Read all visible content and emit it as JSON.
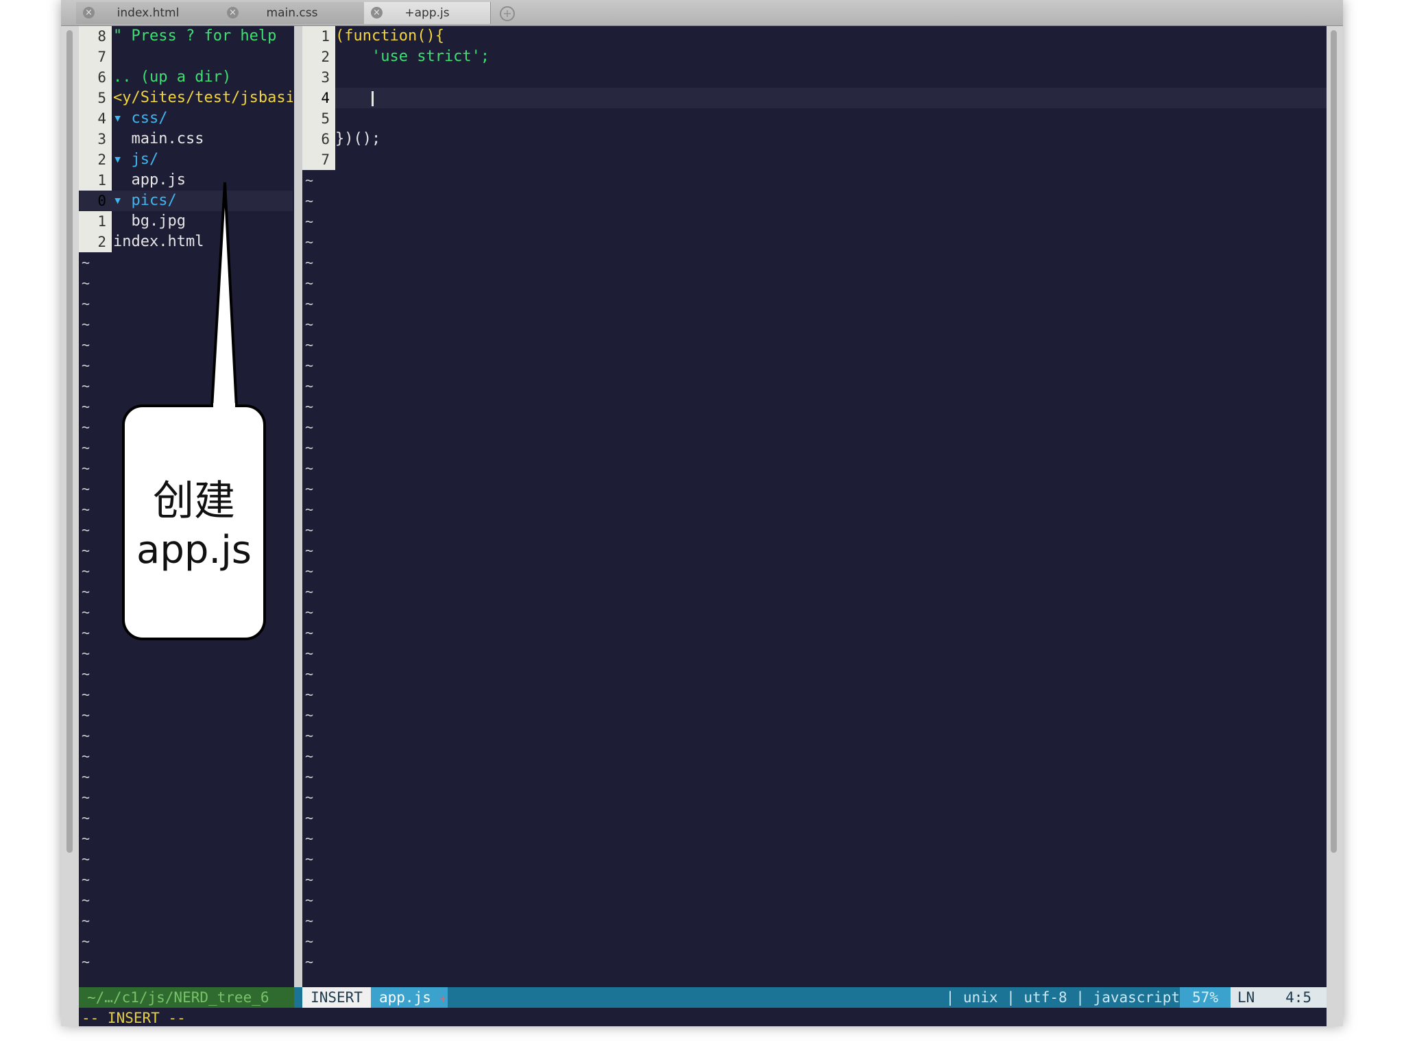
{
  "tabs": [
    {
      "label": "index.html",
      "active": false
    },
    {
      "label": "main.css",
      "active": false
    },
    {
      "label": "+app.js",
      "active": true
    }
  ],
  "tab_close_glyph": "×",
  "tab_add_glyph": "+",
  "tree": {
    "lines": [
      {
        "num": "8",
        "text": "\" Press ? for help",
        "color": "green"
      },
      {
        "num": "7",
        "text": "",
        "color": "white"
      },
      {
        "num": "6",
        "text": ".. (up a dir)",
        "color": "green"
      },
      {
        "num": "5",
        "text": "<y/Sites/test/jsbasic",
        "color": "yellow"
      },
      {
        "num": "4",
        "text": "▾ css/",
        "color": "cyan"
      },
      {
        "num": "3",
        "text": "  main.css",
        "color": "white"
      },
      {
        "num": "2",
        "text": "▾ js/",
        "color": "cyan"
      },
      {
        "num": "1",
        "text": "  app.js",
        "color": "white"
      },
      {
        "num": "0",
        "text": "▾ pics/",
        "color": "cyan"
      },
      {
        "num": "1",
        "text": "  bg.jpg",
        "color": "white"
      },
      {
        "num": "2",
        "text": "index.html",
        "color": "white"
      }
    ],
    "tilde": "~"
  },
  "code": {
    "lines": [
      {
        "num": "1",
        "text": "(function(){",
        "color": "yellow"
      },
      {
        "num": "2",
        "text": "    'use strict';",
        "color": "green"
      },
      {
        "num": "3",
        "text": "",
        "color": "white"
      },
      {
        "num": "4",
        "text": "",
        "color": "white"
      },
      {
        "num": "5",
        "text": "",
        "color": "white"
      },
      {
        "num": "6",
        "text": "})();",
        "color": "white"
      },
      {
        "num": "7",
        "text": "",
        "color": "white"
      }
    ],
    "tilde": "~"
  },
  "status": {
    "left": "~/…/c1/js/NERD_tree_6",
    "mode": "INSERT",
    "file": "app.js",
    "modified": "+",
    "info": "| unix | utf-8 | javascript",
    "percent": "57%",
    "ln_label": "LN",
    "position": "4:5"
  },
  "cmdline": "-- INSERT --",
  "callout": {
    "line1": "创建",
    "line2": "app.js"
  }
}
